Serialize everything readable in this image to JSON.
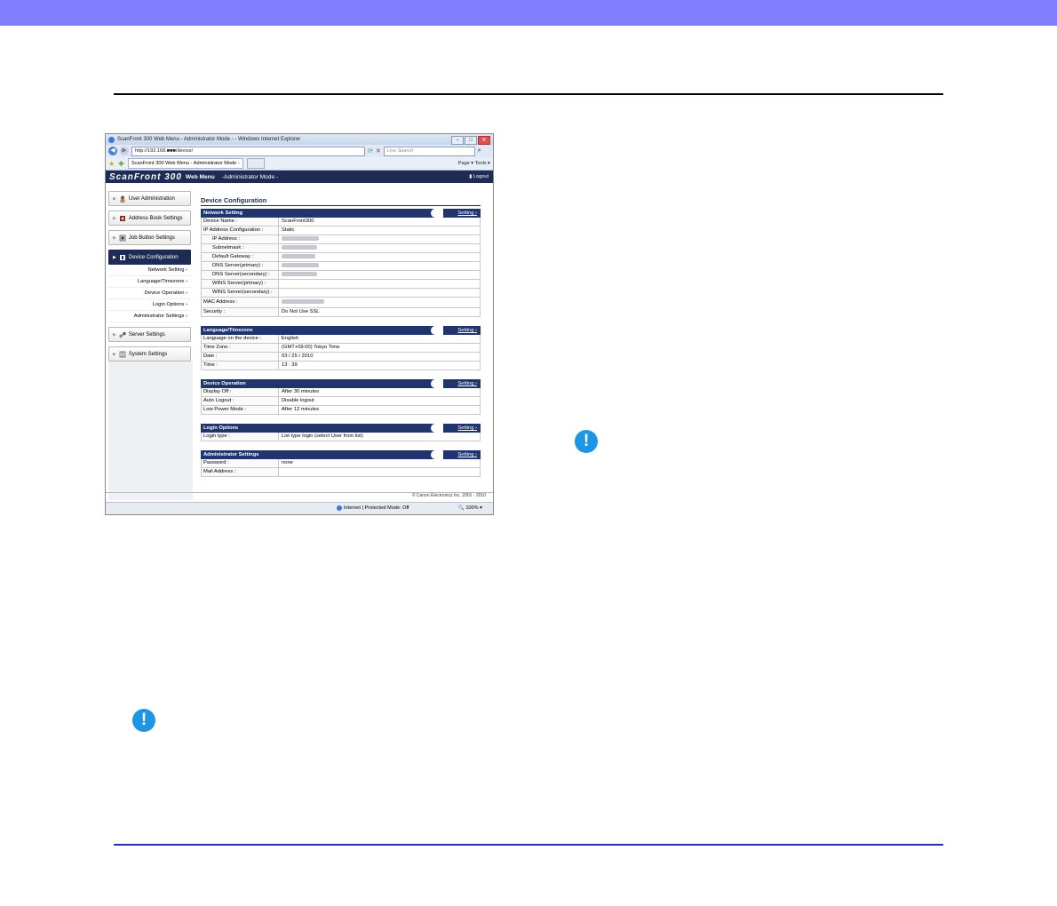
{
  "browser": {
    "title": "ScanFront 300 Web Menu - Administrator Mode - - Windows Internet Explorer",
    "address": "http://192.168.■■■/device/",
    "search_placeholder": "Live Search",
    "tab_label": "ScanFront 300 Web Menu - Administrator Mode -",
    "command_bar": "Page ▾  Tools ▾",
    "status_zone": "Internet | Protected Mode: Off",
    "zoom": "100%"
  },
  "app": {
    "brand": "ScanFront 300",
    "web_menu": "Web Menu",
    "mode": "-Administrator Mode -",
    "logout": "Logout",
    "copyright": "© Canon Electronics Inc. 2001 - 2010"
  },
  "sidebar": {
    "items": [
      {
        "label": "User Administration"
      },
      {
        "label": "Address Book Settings"
      },
      {
        "label": "Job Button Settings"
      },
      {
        "label": "Device Configuration"
      },
      {
        "label": "Server Settings"
      },
      {
        "label": "System Settings"
      }
    ],
    "sub": [
      "Network Setting",
      "Language/Timezone",
      "Device Operation",
      "Login Options",
      "Administrator Settings"
    ]
  },
  "content": {
    "heading": "Device Configuration",
    "settings_link": "Setting",
    "network": {
      "title": "Network Setting",
      "rows": [
        {
          "k": "Device Name :",
          "v": "ScanFront300"
        },
        {
          "k": "IP Address Configuration :",
          "v": "Static"
        },
        {
          "k": "IP Address :",
          "v": ""
        },
        {
          "k": "Subnetmask :",
          "v": ""
        },
        {
          "k": "Default Gateway :",
          "v": ""
        },
        {
          "k": "DNS Server(primary) :",
          "v": ""
        },
        {
          "k": "DNS Server(secondary) :",
          "v": ""
        },
        {
          "k": "WINS Server(primary) :",
          "v": ""
        },
        {
          "k": "WINS Server(secondary) :",
          "v": ""
        },
        {
          "k": "MAC Address :",
          "v": ""
        },
        {
          "k": "Security :",
          "v": "Do Not Use SSL"
        }
      ]
    },
    "language": {
      "title": "Language/Timezone",
      "rows": [
        {
          "k": "Language on the device :",
          "v": "English"
        },
        {
          "k": "Time Zone :",
          "v": "(GMT+09:00) Tokyo Time"
        },
        {
          "k": "Date :",
          "v": "03 / 25 / 2010"
        },
        {
          "k": "Time :",
          "v": "13 : 39"
        }
      ]
    },
    "operation": {
      "title": "Device Operation",
      "rows": [
        {
          "k": "Display Off :",
          "v": "After 30 minutes"
        },
        {
          "k": "Auto Logout :",
          "v": "Disable logout"
        },
        {
          "k": "Low Power Mode :",
          "v": "After 12 minutes"
        }
      ]
    },
    "login": {
      "title": "Login Options",
      "rows": [
        {
          "k": "Login type :",
          "v": "List type login (select User from list)"
        }
      ]
    },
    "admin": {
      "title": "Administrator Settings",
      "rows": [
        {
          "k": "Password :",
          "v": "none"
        },
        {
          "k": "Mail Address :",
          "v": ""
        }
      ]
    }
  },
  "page": {
    "warning_glyph": "!",
    "colors": {
      "top_band": "#8080ff",
      "accent": "#1e2c55",
      "warning": "#1e96e6"
    }
  }
}
